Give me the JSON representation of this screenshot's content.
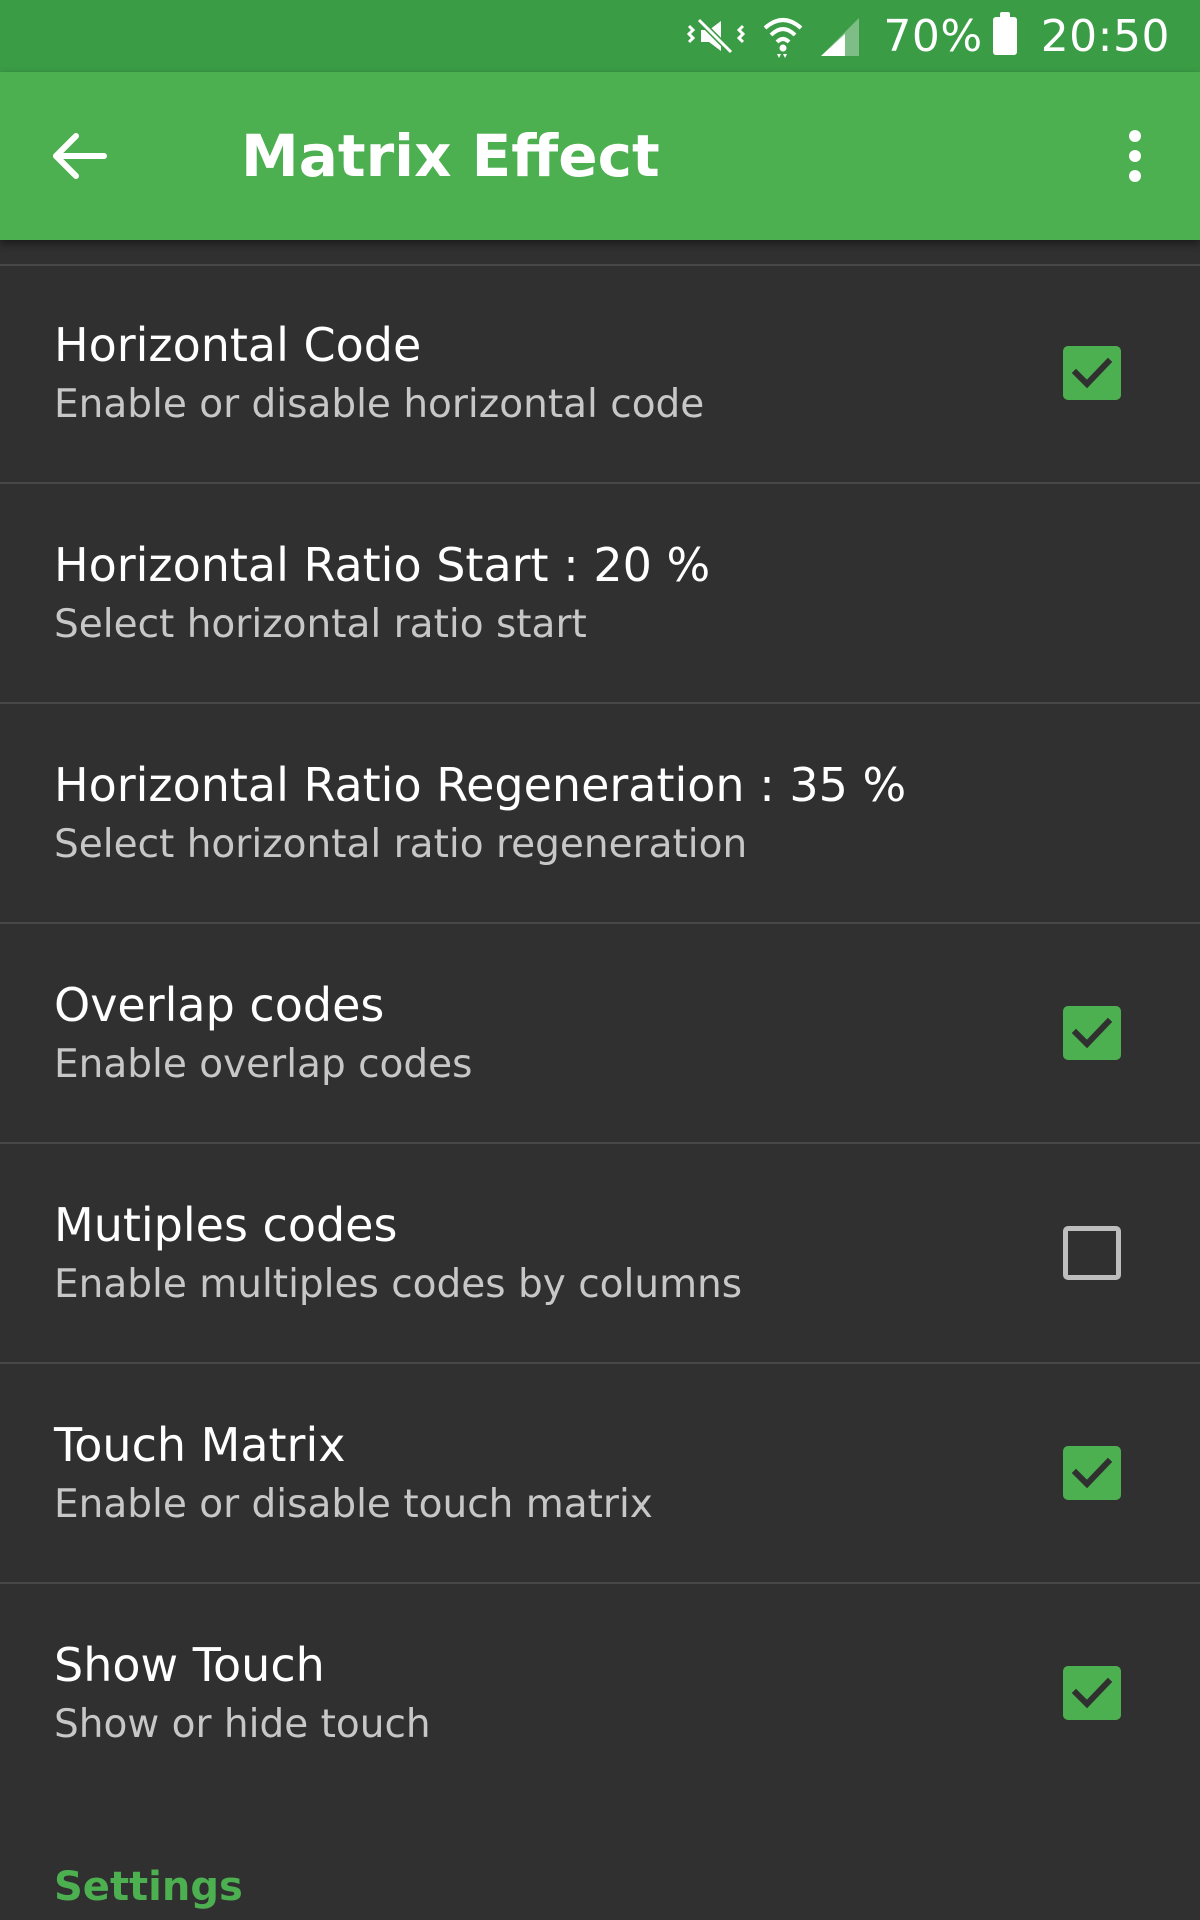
{
  "status_bar": {
    "battery_percent": "70%",
    "time": "20:50",
    "icons": [
      "mute-vibrate-icon",
      "wifi-icon",
      "cell-signal-icon",
      "battery-icon"
    ]
  },
  "app_bar": {
    "title": "Matrix Effect",
    "back_icon": "arrow-back-icon",
    "menu_icon": "overflow-menu-icon"
  },
  "colors": {
    "status_bar": "#3a9c45",
    "app_bar": "#4caf50",
    "accent": "#4caf50",
    "background": "#303030"
  },
  "preferences": [
    {
      "title": "Horizontal Code",
      "summary": "Enable or disable horizontal code",
      "checkbox": true,
      "checked": true
    },
    {
      "title": "Horizontal Ratio Start : 20 %",
      "summary": "Select horizontal ratio start",
      "checkbox": false
    },
    {
      "title": "Horizontal Ratio Regeneration : 35 %",
      "summary": "Select horizontal ratio regeneration",
      "checkbox": false
    },
    {
      "title": "Overlap codes",
      "summary": "Enable overlap codes",
      "checkbox": true,
      "checked": true
    },
    {
      "title": "Mutiples codes",
      "summary": "Enable multiples codes by columns",
      "checkbox": true,
      "checked": false
    },
    {
      "title": "Touch Matrix",
      "summary": "Enable or disable touch matrix",
      "checkbox": true,
      "checked": true
    },
    {
      "title": "Show Touch",
      "summary": "Show or hide touch",
      "checkbox": true,
      "checked": true
    }
  ],
  "section_header": "Settings"
}
